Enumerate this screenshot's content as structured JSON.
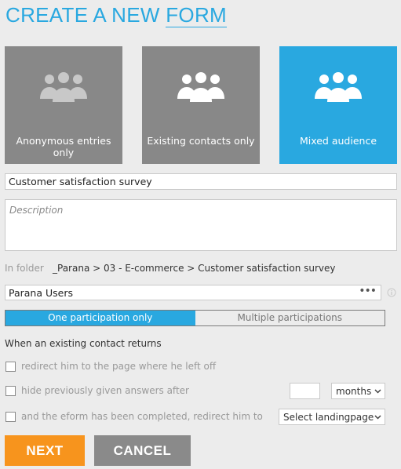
{
  "header": {
    "title_part1": "CREATE A NEW",
    "title_part2": "FORM"
  },
  "audience": [
    {
      "label": "Anonymous entries only",
      "icon": "group-icon",
      "active": false
    },
    {
      "label": "Existing contacts only",
      "icon": "group-icon",
      "active": false
    },
    {
      "label": "Mixed audience",
      "icon": "group-icon",
      "active": true
    }
  ],
  "form": {
    "name_value": "Customer satisfaction survey",
    "description_placeholder": "Description",
    "folder_label": "In folder",
    "folder_path": "_Parana > 03 - E-commerce > Customer satisfaction survey",
    "users_value": "Parana Users",
    "users_more": "•••"
  },
  "participation": {
    "options": [
      "One participation only",
      "Multiple participations"
    ],
    "selected": "One participation only"
  },
  "returning": {
    "heading": "When an existing contact returns",
    "option1": "redirect him to the page where he left off",
    "option2": "hide previously given answers after",
    "option3": "and the eform has been completed, redirect him to",
    "months_value": "months",
    "landing_value": "Select landingpage"
  },
  "actions": {
    "next": "NEXT",
    "cancel": "CANCEL"
  },
  "colors": {
    "accent": "#29a8e0",
    "tile": "#888888",
    "next": "#f7941d",
    "cancel": "#8a8a8a"
  }
}
